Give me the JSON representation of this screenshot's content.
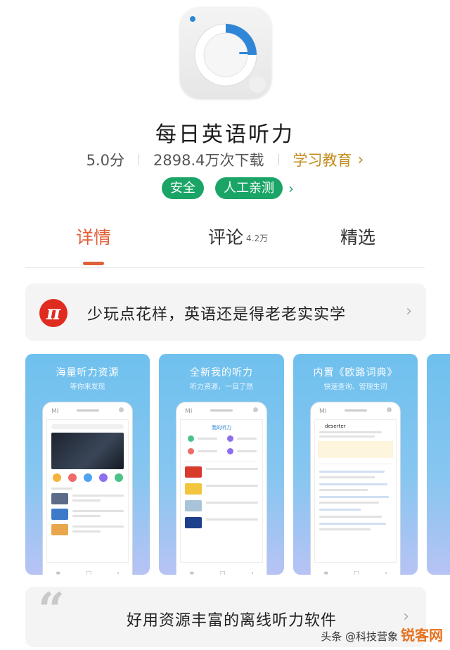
{
  "app": {
    "name": "每日英语听力",
    "rating": "5.0分",
    "downloads": "2898.4万次下载",
    "category": "学习教育",
    "badges": [
      "安全",
      "人工亲测"
    ]
  },
  "tabs": [
    {
      "label": "详情",
      "count": ""
    },
    {
      "label": "评论",
      "count": "4.2万"
    },
    {
      "label": "精选",
      "count": ""
    }
  ],
  "active_tab": "详情",
  "promo": {
    "icon_text": "π",
    "text": "少玩点花样，英语还是得老老实实学"
  },
  "screenshots": [
    {
      "caption": "海量听力资源",
      "subcaption": "等你来发现"
    },
    {
      "caption": "全新我的听力",
      "subcaption": "听力资源，一目了然",
      "screen_title": "我的听力"
    },
    {
      "caption": "内置《欧路词典》",
      "subcaption": "快速查询、管理生词",
      "word": "deserter"
    }
  ],
  "review": {
    "quote_mark": "“",
    "text": "好用资源丰富的离线听力软件"
  },
  "watermark": {
    "text": "头条 @科技营象",
    "logo": "锐客网"
  },
  "colors": {
    "accent": "#e0603a",
    "badge": "#1aa567",
    "category": "#c28c1a"
  }
}
